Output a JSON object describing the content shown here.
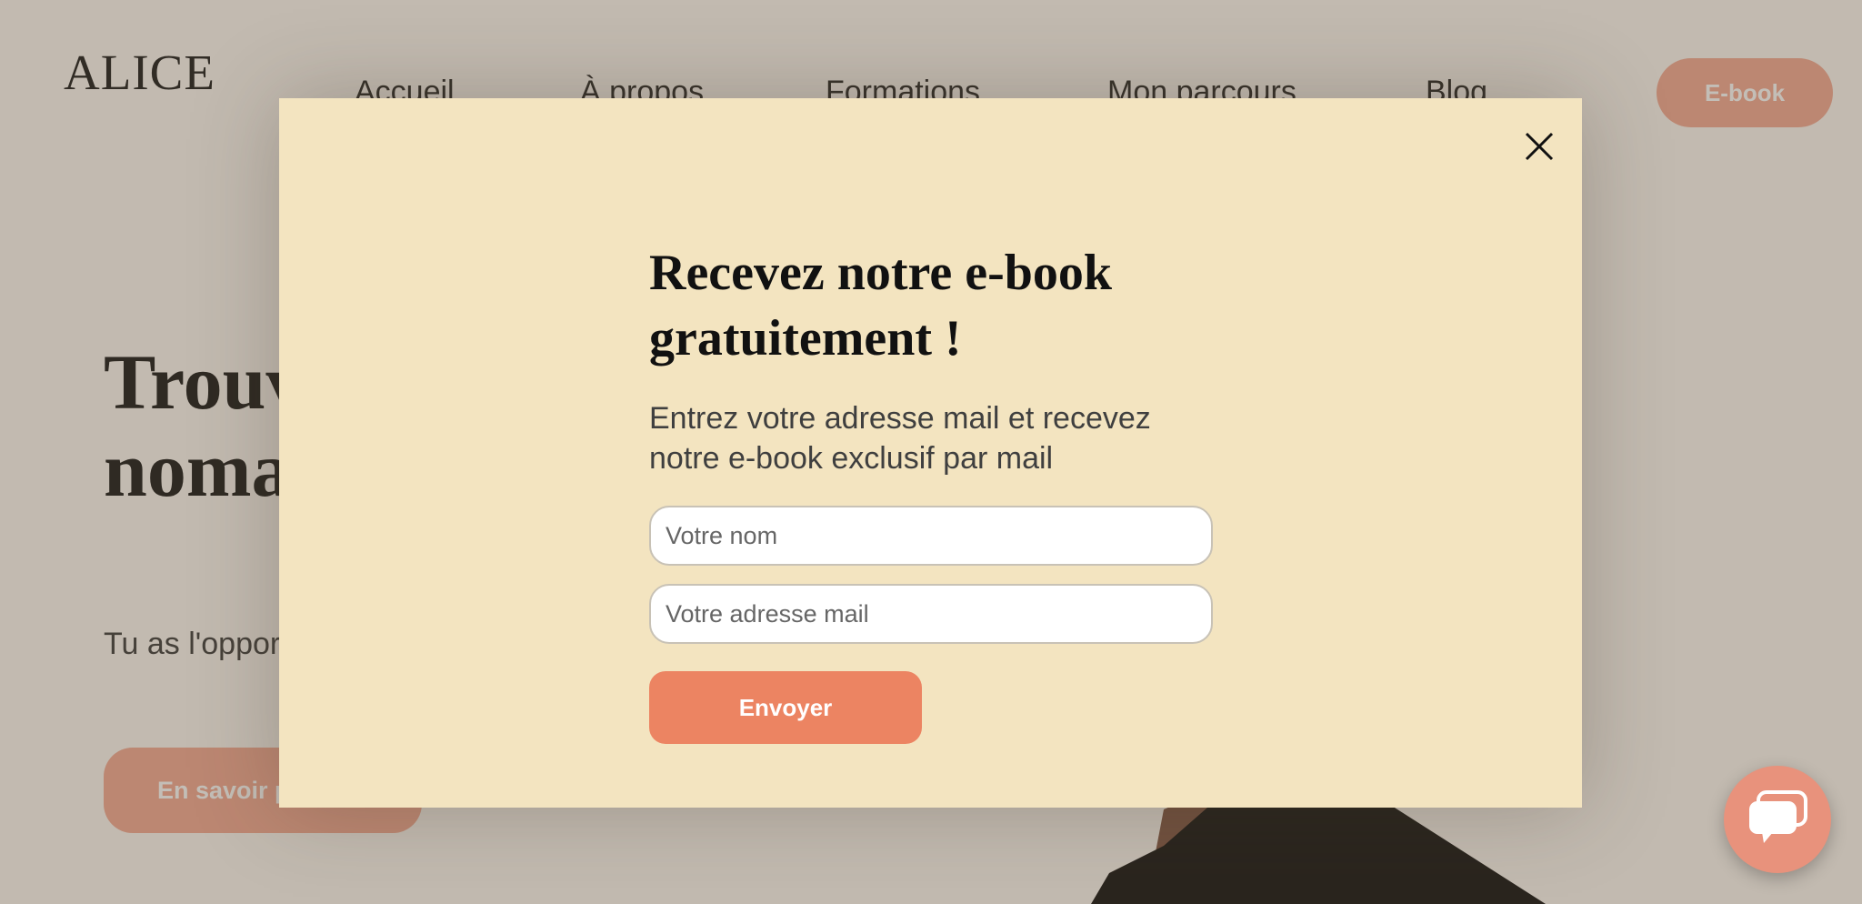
{
  "site": {
    "logo": "ALICE"
  },
  "nav": {
    "items": [
      "Accueil",
      "À propos",
      "Formations",
      "Mon parcours",
      "Blog"
    ],
    "cta_label": "E-book"
  },
  "hero": {
    "title": "Trouver votre ligne de vie nomade",
    "subtitle": "Tu as l'opportunité de parcourir le monde gratuitement",
    "button_label": "En savoir plus"
  },
  "modal": {
    "title": "Recevez notre e-book gratuitement !",
    "description": "Entrez votre adresse mail et recevez notre e-book exclusif par mail",
    "name_placeholder": "Votre nom",
    "email_placeholder": "Votre adresse mail",
    "submit_label": "Envoyer",
    "close_icon": "close-icon"
  },
  "chat": {
    "icon": "chat-bubble-icon"
  },
  "colors": {
    "accent": "#ec8462",
    "button_soft": "#f3a58e",
    "modal_bg": "#f3e4c0",
    "overlay": "rgba(100,88,70,0.39)"
  }
}
